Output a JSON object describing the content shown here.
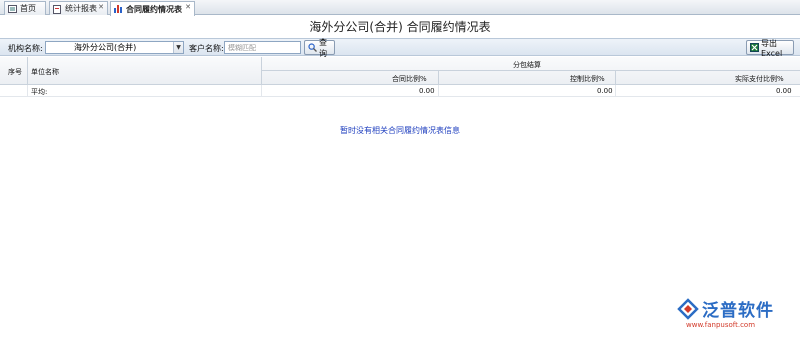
{
  "tabs": [
    {
      "label": "首页",
      "icon": "home-icon"
    },
    {
      "label": "统计报表",
      "icon": "report-icon",
      "close": "✕"
    },
    {
      "label": "合同履约情况表",
      "icon": "bar-chart-icon",
      "close": "✕",
      "active": true
    }
  ],
  "page_title": "海外分公司(合并) 合同履约情况表",
  "filters": {
    "org_label": "机构名称:",
    "org_value": "海外分公司(合并)",
    "customer_label": "客户名称:",
    "customer_placeholder": "模糊匹配",
    "search_button": "查询",
    "export_button": "导出Excel"
  },
  "table": {
    "col_index": "序号",
    "col_unit": "单位名称",
    "group_header": "分包结算",
    "sub_headers": [
      "合同比例%",
      "控制比例%",
      "实际支付比例%"
    ],
    "average_row": {
      "label": "平均:",
      "values": [
        "0.00",
        "0.00",
        "0.00"
      ]
    }
  },
  "empty_message": "暂时没有相关合同履约情况表信息",
  "branding": {
    "name": "泛普软件",
    "url": "www.fanpusoft.com"
  },
  "colors": {
    "accent": "#2b6cc4",
    "link": "#1f3fbf",
    "url": "#d23a2a"
  }
}
